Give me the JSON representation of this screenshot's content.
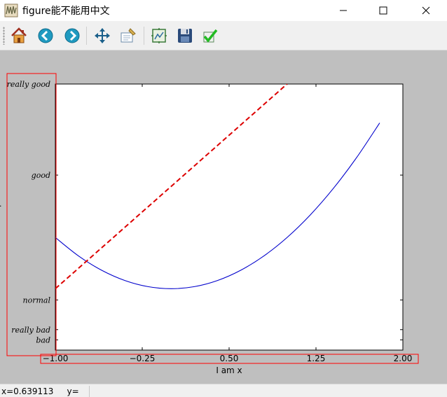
{
  "window": {
    "title": "figure能不能用中文",
    "app_icon": "matplotlib-figure-icon",
    "controls": [
      "minimize-icon",
      "maximize-icon",
      "close-icon"
    ]
  },
  "toolbar": {
    "buttons": [
      {
        "name": "home",
        "icon": "home-icon"
      },
      {
        "name": "back",
        "icon": "arrow-left-icon"
      },
      {
        "name": "forward",
        "icon": "arrow-right-icon"
      },
      {
        "name": "pan",
        "icon": "move-arrows-icon"
      },
      {
        "name": "zoom",
        "icon": "zoom-rect-icon"
      },
      {
        "name": "subplots",
        "icon": "subplots-config-icon"
      },
      {
        "name": "save",
        "icon": "floppy-disk-icon"
      },
      {
        "name": "edit",
        "icon": "checkmark-icon"
      }
    ]
  },
  "status": {
    "text": "x=0.639113     y="
  },
  "colors": {
    "figure_bg": "#bfbfbf",
    "axes_bg": "#ffffff",
    "curve": "#0000cc",
    "dashed_line": "#dd0000",
    "highlight_box": "#ff0000"
  },
  "chart_data": {
    "type": "line",
    "title": "",
    "xlabel": "I am x",
    "ylabel": "",
    "xlim": [
      -1.0,
      2.0
    ],
    "ylim": [
      -2.2,
      3.0
    ],
    "x_ticks": [
      {
        "value": -1.0,
        "label": "−1.00"
      },
      {
        "value": -0.25,
        "label": "−0.25"
      },
      {
        "value": 0.5,
        "label": "0.50"
      },
      {
        "value": 1.25,
        "label": "1.25"
      },
      {
        "value": 2.0,
        "label": "2.00"
      }
    ],
    "y_ticks": [
      {
        "value": -2.0,
        "label": "bad"
      },
      {
        "value": -1.8,
        "label": "really bad"
      },
      {
        "value": -1.22,
        "label": "normal"
      },
      {
        "value": 1.22,
        "label": "good"
      },
      {
        "value": 3.0,
        "label": "really good"
      }
    ],
    "grid": false,
    "series": [
      {
        "style": "solid",
        "color": "#0000cc",
        "x": [
          -1.0,
          -0.8,
          -0.6,
          -0.4,
          -0.2,
          0.0,
          0.2,
          0.4,
          0.6,
          0.8,
          1.0,
          1.2,
          1.4,
          1.6,
          1.8
        ],
        "y": [
          0.0,
          -0.36,
          -0.64,
          -0.84,
          -0.96,
          -1.0,
          -0.96,
          -0.84,
          -0.64,
          -0.36,
          0.0,
          0.44,
          0.96,
          1.56,
          2.24
        ]
      },
      {
        "style": "dashed",
        "color": "#dd0000",
        "x": [
          -1.0,
          1.0
        ],
        "y": [
          -1.0,
          3.0
        ]
      }
    ]
  }
}
